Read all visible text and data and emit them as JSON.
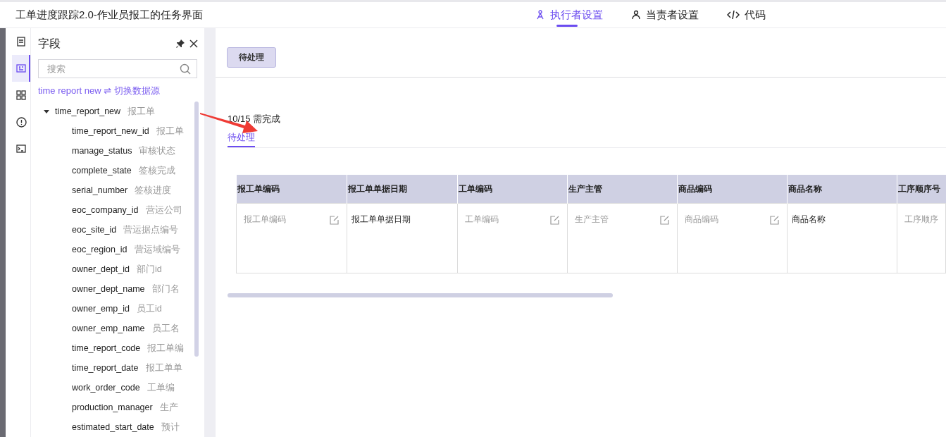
{
  "window": {
    "title": "工单进度跟踪2.0-作业员报工的任务界面"
  },
  "tabs": [
    {
      "label": "执行者设置",
      "selected": true
    },
    {
      "label": "当责者设置",
      "selected": false
    },
    {
      "label": "代码",
      "selected": false
    }
  ],
  "rail": [
    {
      "selected": false
    },
    {
      "selected": true
    },
    {
      "selected": false
    },
    {
      "selected": false
    },
    {
      "selected": false
    }
  ],
  "field_panel": {
    "title": "字段",
    "search": {
      "placeholder": "搜索"
    },
    "source": "time report new ⇌ 切换数据源",
    "tree": [
      {
        "name": "time_report_new",
        "label": "报工单",
        "expanded": true,
        "children": [
          {
            "name": "time_report_new_id",
            "label": "报工单"
          },
          {
            "name": "manage_status",
            "label": "审核状态"
          },
          {
            "name": "complete_state",
            "label": "签核完成"
          },
          {
            "name": "serial_number",
            "label": "签核进度"
          },
          {
            "name": "eoc_company_id",
            "label": "营运公司"
          },
          {
            "name": "eoc_site_id",
            "label": "营运据点编号"
          },
          {
            "name": "eoc_region_id",
            "label": "营运域编号"
          },
          {
            "name": "owner_dept_id",
            "label": "部门id"
          },
          {
            "name": "owner_dept_name",
            "label": "部门名"
          },
          {
            "name": "owner_emp_id",
            "label": "员工id"
          },
          {
            "name": "owner_emp_name",
            "label": "员工名"
          },
          {
            "name": "time_report_code",
            "label": "报工单编"
          },
          {
            "name": "time_report_date",
            "label": "报工单单"
          },
          {
            "name": "work_order_code",
            "label": "工单编"
          },
          {
            "name": "production_manager",
            "label": "生产"
          },
          {
            "name": "estimated_start_date",
            "label": "预计"
          }
        ]
      }
    ]
  },
  "main": {
    "status_button": "待处理",
    "progress": "10/15 需完成",
    "sub_tabs": [
      {
        "label": "待处理",
        "selected": true
      }
    ],
    "table": {
      "columns": [
        {
          "title": "报工单编码",
          "kind": "input",
          "cell": "报工单编码"
        },
        {
          "title": "报工单单据日期",
          "kind": "text",
          "cell": "报工单单据日期"
        },
        {
          "title": "工单编码",
          "kind": "input",
          "cell": "工单编码"
        },
        {
          "title": "生产主管",
          "kind": "input",
          "cell": "生产主管"
        },
        {
          "title": "商品编码",
          "kind": "input",
          "cell": "商品编码"
        },
        {
          "title": "商品名称",
          "kind": "text",
          "cell": "商品名称"
        },
        {
          "title": "工序顺序号",
          "kind": "input",
          "cell": "工序顺序"
        }
      ]
    }
  }
}
